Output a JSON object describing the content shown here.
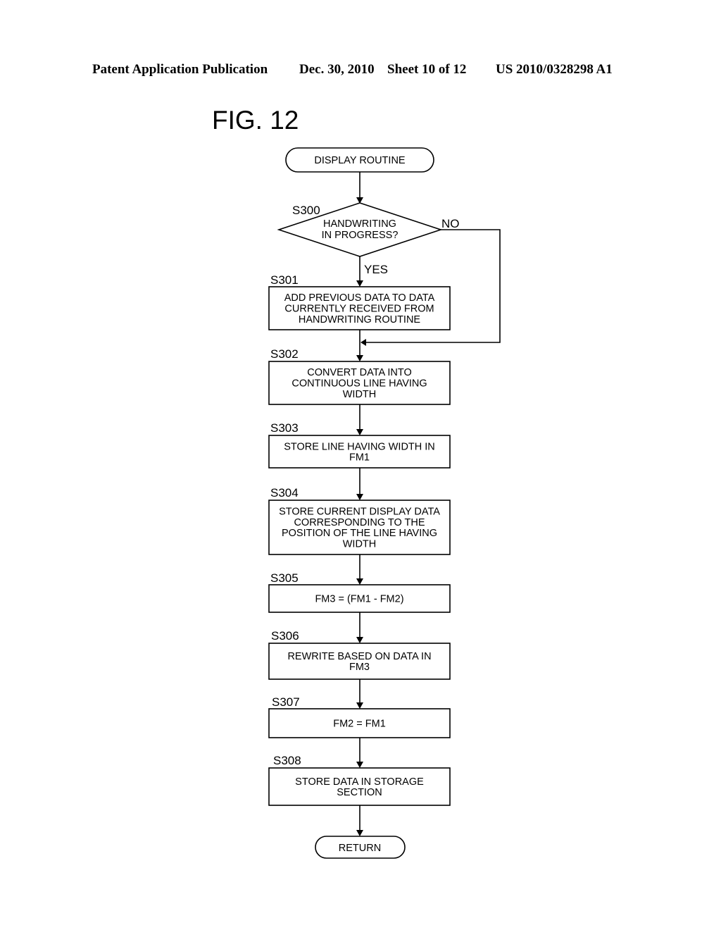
{
  "header": {
    "publication": "Patent Application Publication",
    "date": "Dec. 30, 2010",
    "sheet": "Sheet 10 of 12",
    "number": "US 2010/0328298 A1"
  },
  "figure": {
    "title": "FIG. 12",
    "start": {
      "label": "DISPLAY ROUTINE"
    },
    "decision": {
      "step": "S300",
      "lines": [
        "HANDWRITING",
        "IN PROGRESS?"
      ],
      "yes_label": "YES",
      "no_label": "NO"
    },
    "steps": [
      {
        "id": "S301",
        "lines": [
          "ADD PREVIOUS DATA TO DATA",
          "CURRENTLY RECEIVED FROM",
          "HANDWRITING ROUTINE"
        ]
      },
      {
        "id": "S302",
        "lines": [
          "CONVERT DATA INTO",
          "CONTINUOUS LINE HAVING",
          "WIDTH"
        ]
      },
      {
        "id": "S303",
        "lines": [
          "STORE LINE HAVING WIDTH IN",
          "FM1"
        ]
      },
      {
        "id": "S304",
        "lines": [
          "STORE CURRENT DISPLAY DATA",
          "CORRESPONDING TO THE",
          "POSITION OF THE LINE HAVING",
          "WIDTH"
        ]
      },
      {
        "id": "S305",
        "lines": [
          "FM3 = (FM1 - FM2)"
        ]
      },
      {
        "id": "S306",
        "lines": [
          "REWRITE BASED ON DATA IN",
          "FM3"
        ]
      },
      {
        "id": "S307",
        "lines": [
          "FM2 = FM1"
        ]
      },
      {
        "id": "S308",
        "lines": [
          "STORE DATA IN STORAGE",
          "SECTION"
        ]
      }
    ],
    "end": {
      "label": "RETURN"
    }
  }
}
